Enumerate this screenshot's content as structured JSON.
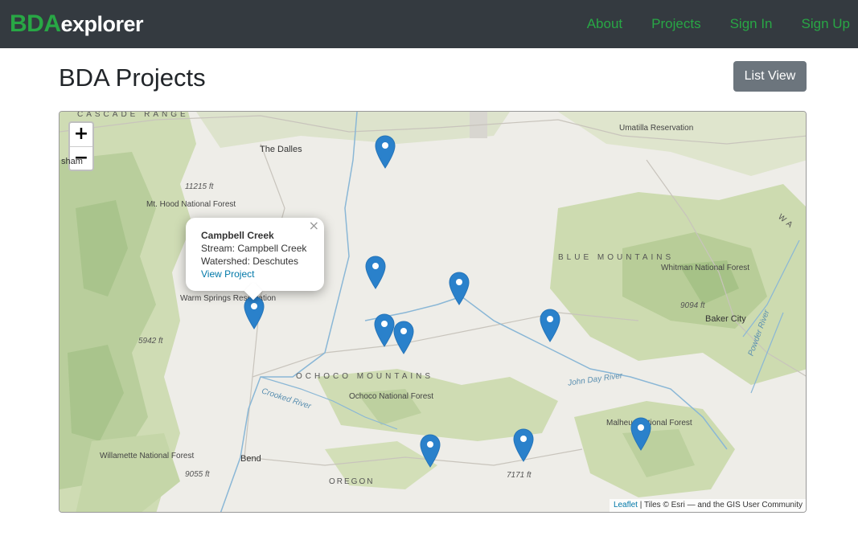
{
  "navbar": {
    "brand_prefix": "BDA",
    "brand_suffix": "explorer",
    "links": [
      {
        "label": "About"
      },
      {
        "label": "Projects"
      },
      {
        "label": "Sign In"
      },
      {
        "label": "Sign Up"
      }
    ]
  },
  "page": {
    "title": "BDA Projects",
    "list_view_label": "List View"
  },
  "map": {
    "zoom_in": "+",
    "zoom_out": "−",
    "labels": {
      "cascade_range": "CASCADE RANGE",
      "the_dalles": "The Dalles",
      "sham": "sham",
      "umatilla": "Umatilla Reservation",
      "elev_11215": "11215 ft",
      "mt_hood": "Mt. Hood National Forest",
      "blue_mountains": "BLUE MOUNTAINS",
      "whitman": "Whitman National Forest",
      "warm_springs": "Warm Springs Reservation",
      "elev_9094": "9094 ft",
      "baker_city": "Baker City",
      "elev_5942": "5942 ft",
      "ochoco_mountains": "OCHOCO MOUNTAINS",
      "john_day_river": "John Day River",
      "crooked_river": "Crooked River",
      "ochoco_nf": "Ochoco National Forest",
      "malheur": "Malheur National Forest",
      "willamette": "Willamette National Forest",
      "bend": "Bend",
      "elev_9055": "9055 ft",
      "oregon": "OREGON",
      "elev_7171": "7171 ft",
      "wa": "WA",
      "powder_river": "Powder River"
    },
    "popup": {
      "title": "Campbell Creek",
      "stream": "Stream: Campbell Creek",
      "watershed": "Watershed: Deschutes",
      "link": "View Project",
      "close": "×"
    },
    "attribution": {
      "leaflet": "Leaflet",
      "rest": " | Tiles © Esri — and the GIS User Community"
    }
  }
}
